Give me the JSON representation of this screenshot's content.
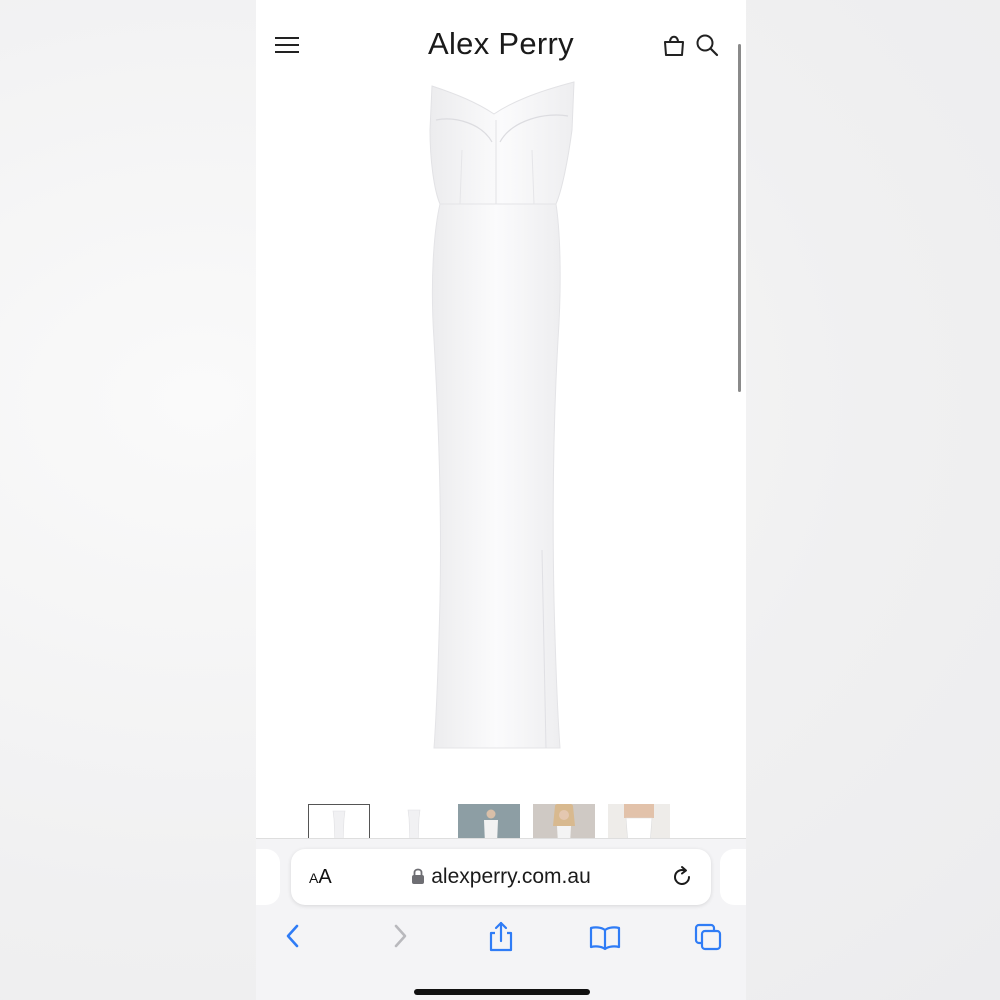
{
  "header": {
    "brand": "Alex Perry",
    "menu_icon": "hamburger-menu-icon",
    "bag_icon": "shopping-bag-icon",
    "search_icon": "search-icon"
  },
  "product": {
    "image_icon": "white-strapless-gown-image",
    "thumbnails": [
      {
        "name": "thumbnail-gown-front",
        "selected": true
      },
      {
        "name": "thumbnail-gown-back",
        "selected": false
      },
      {
        "name": "thumbnail-model-grey-backdrop",
        "selected": false
      },
      {
        "name": "thumbnail-model-blonde",
        "selected": false
      },
      {
        "name": "thumbnail-model-closeup",
        "selected": false
      }
    ]
  },
  "browser": {
    "aa_large": "A",
    "aa_small": "A",
    "url": "alexperry.com.au",
    "lock_icon": "lock-icon",
    "reload_icon": "reload-icon",
    "toolbar": [
      "back-icon",
      "forward-icon",
      "share-icon",
      "bookmarks-icon",
      "tabs-icon"
    ]
  },
  "colors": {
    "ios_blue": "#2f7cf6",
    "disabled_gray": "#b9b9bd",
    "text": "#1a1a1a"
  }
}
